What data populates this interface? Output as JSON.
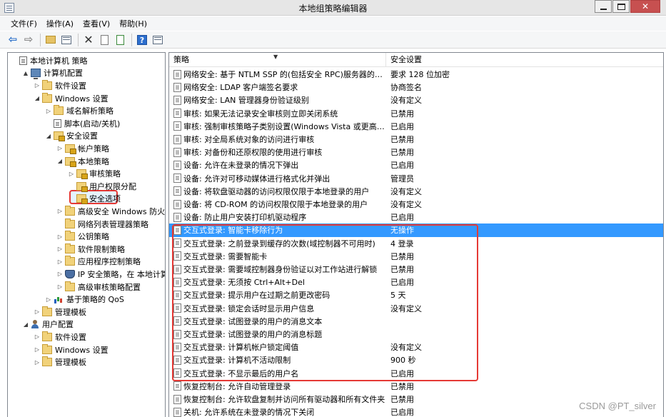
{
  "window": {
    "title": "本地组策略编辑器"
  },
  "menu": [
    "文件(F)",
    "操作(A)",
    "查看(V)",
    "帮助(H)"
  ],
  "toolbar": [
    "back-icon",
    "forward-icon",
    "up-folder-icon",
    "show-hide-tree-icon",
    "delete-icon",
    "properties-icon",
    "export-icon",
    "help-icon",
    "view-icon"
  ],
  "tree": [
    {
      "label": "本地计算机 策略",
      "level": 0,
      "toggle": "",
      "icon": "doc",
      "name": "tree-local-computer-policy"
    },
    {
      "label": "计算机配置",
      "level": 1,
      "toggle": "▲",
      "icon": "computer",
      "name": "tree-computer-config"
    },
    {
      "label": "软件设置",
      "level": 2,
      "toggle": "▷",
      "icon": "folder",
      "name": "tree-software-settings"
    },
    {
      "label": "Windows 设置",
      "level": 2,
      "toggle": "◢",
      "icon": "folder",
      "name": "tree-windows-settings"
    },
    {
      "label": "域名解析策略",
      "level": 3,
      "toggle": "▷",
      "icon": "folder",
      "name": "tree-name-resolution-policy"
    },
    {
      "label": "脚本(启动/关机)",
      "level": 3,
      "toggle": "",
      "icon": "doc",
      "name": "tree-scripts"
    },
    {
      "label": "安全设置",
      "level": 3,
      "toggle": "◢",
      "icon": "lockfolder",
      "name": "tree-security-settings"
    },
    {
      "label": "帐户策略",
      "level": 4,
      "toggle": "▷",
      "icon": "lockfolder",
      "name": "tree-account-policies"
    },
    {
      "label": "本地策略",
      "level": 4,
      "toggle": "◢",
      "icon": "lockfolder",
      "name": "tree-local-policies"
    },
    {
      "label": "审核策略",
      "level": 5,
      "toggle": "▷",
      "icon": "lockfolder",
      "name": "tree-audit-policy"
    },
    {
      "label": "用户权限分配",
      "level": 5,
      "toggle": "",
      "icon": "lockfolder",
      "name": "tree-user-rights"
    },
    {
      "label": "安全选项",
      "level": 5,
      "toggle": "",
      "icon": "lockfolder",
      "name": "tree-security-options"
    },
    {
      "label": "高级安全 Windows 防火墙",
      "level": 4,
      "toggle": "▷",
      "icon": "folder",
      "name": "tree-firewall"
    },
    {
      "label": "网络列表管理器策略",
      "level": 4,
      "toggle": "",
      "icon": "folder",
      "name": "tree-network-list"
    },
    {
      "label": "公钥策略",
      "level": 4,
      "toggle": "▷",
      "icon": "folder",
      "name": "tree-public-key"
    },
    {
      "label": "软件限制策略",
      "level": 4,
      "toggle": "▷",
      "icon": "folder",
      "name": "tree-software-restriction"
    },
    {
      "label": "应用程序控制策略",
      "level": 4,
      "toggle": "▷",
      "icon": "folder",
      "name": "tree-app-control"
    },
    {
      "label": "IP 安全策略，在 本地计算机",
      "level": 4,
      "toggle": "▷",
      "icon": "shield",
      "name": "tree-ip-security"
    },
    {
      "label": "高级审核策略配置",
      "level": 4,
      "toggle": "▷",
      "icon": "folder",
      "name": "tree-advanced-audit"
    },
    {
      "label": "基于策略的 QoS",
      "level": 3,
      "toggle": "▷",
      "icon": "chart",
      "name": "tree-qos"
    },
    {
      "label": "管理模板",
      "level": 2,
      "toggle": "▷",
      "icon": "folder",
      "name": "tree-admin-templates"
    },
    {
      "label": "用户配置",
      "level": 1,
      "toggle": "◢",
      "icon": "user",
      "name": "tree-user-config"
    },
    {
      "label": "软件设置",
      "level": 2,
      "toggle": "▷",
      "icon": "folder",
      "name": "tree-user-software"
    },
    {
      "label": "Windows 设置",
      "level": 2,
      "toggle": "▷",
      "icon": "folder",
      "name": "tree-user-windows"
    },
    {
      "label": "管理模板",
      "level": 2,
      "toggle": "▷",
      "icon": "folder",
      "name": "tree-user-admin-templates"
    }
  ],
  "table": {
    "headers": {
      "policy": "策略",
      "setting": "安全设置"
    },
    "rows": [
      {
        "policy": "网络安全: 基于 NTLM SSP 的(包括安全 RPC)服务器的最小...",
        "setting": "要求 128 位加密"
      },
      {
        "policy": "网络安全: LDAP 客户端签名要求",
        "setting": "协商签名"
      },
      {
        "policy": "网络安全: LAN 管理器身份验证级别",
        "setting": "没有定义"
      },
      {
        "policy": "审核: 如果无法记录安全审核则立即关闭系统",
        "setting": "已禁用"
      },
      {
        "policy": "审核: 强制审核策略子类别设置(Windows Vista 或更高版本...",
        "setting": "已启用"
      },
      {
        "policy": "审核: 对全局系统对象的访问进行审核",
        "setting": "已禁用"
      },
      {
        "policy": "审核: 对备份和还原权限的使用进行审核",
        "setting": "已禁用"
      },
      {
        "policy": "设备: 允许在未登录的情况下弹出",
        "setting": "已启用"
      },
      {
        "policy": "设备: 允许对可移动媒体进行格式化并弹出",
        "setting": "管理员"
      },
      {
        "policy": "设备: 将软盘驱动器的访问权限仅限于本地登录的用户",
        "setting": "没有定义"
      },
      {
        "policy": "设备: 将 CD-ROM 的访问权限仅限于本地登录的用户",
        "setting": "没有定义"
      },
      {
        "policy": "设备: 防止用户安装打印机驱动程序",
        "setting": "已启用"
      },
      {
        "policy": "交互式登录: 智能卡移除行为",
        "setting": "无操作",
        "selected": true
      },
      {
        "policy": "交互式登录: 之前登录到缓存的次数(域控制器不可用时)",
        "setting": "4 登录"
      },
      {
        "policy": "交互式登录: 需要智能卡",
        "setting": "已禁用"
      },
      {
        "policy": "交互式登录: 需要域控制器身份验证以对工作站进行解锁",
        "setting": "已禁用"
      },
      {
        "policy": "交互式登录: 无须按 Ctrl+Alt+Del",
        "setting": "已启用"
      },
      {
        "policy": "交互式登录: 提示用户在过期之前更改密码",
        "setting": "5 天"
      },
      {
        "policy": "交互式登录: 锁定会话时显示用户信息",
        "setting": "没有定义"
      },
      {
        "policy": "交互式登录: 试图登录的用户的消息文本",
        "setting": ""
      },
      {
        "policy": "交互式登录: 试图登录的用户的消息标题",
        "setting": ""
      },
      {
        "policy": "交互式登录: 计算机帐户锁定阈值",
        "setting": "没有定义"
      },
      {
        "policy": "交互式登录: 计算机不活动限制",
        "setting": "900 秒"
      },
      {
        "policy": "交互式登录: 不显示最后的用户名",
        "setting": "已启用"
      },
      {
        "policy": "恢复控制台: 允许自动管理登录",
        "setting": "已禁用"
      },
      {
        "policy": "恢复控制台: 允许软盘复制并访问所有驱动器和所有文件夹",
        "setting": "已禁用"
      },
      {
        "policy": "关机: 允许系统在未登录的情况下关闭",
        "setting": "已启用"
      }
    ]
  },
  "watermark": "CSDN @PT_silver",
  "colors": {
    "selection": "#3399ff",
    "highlight_box": "#e53935"
  }
}
